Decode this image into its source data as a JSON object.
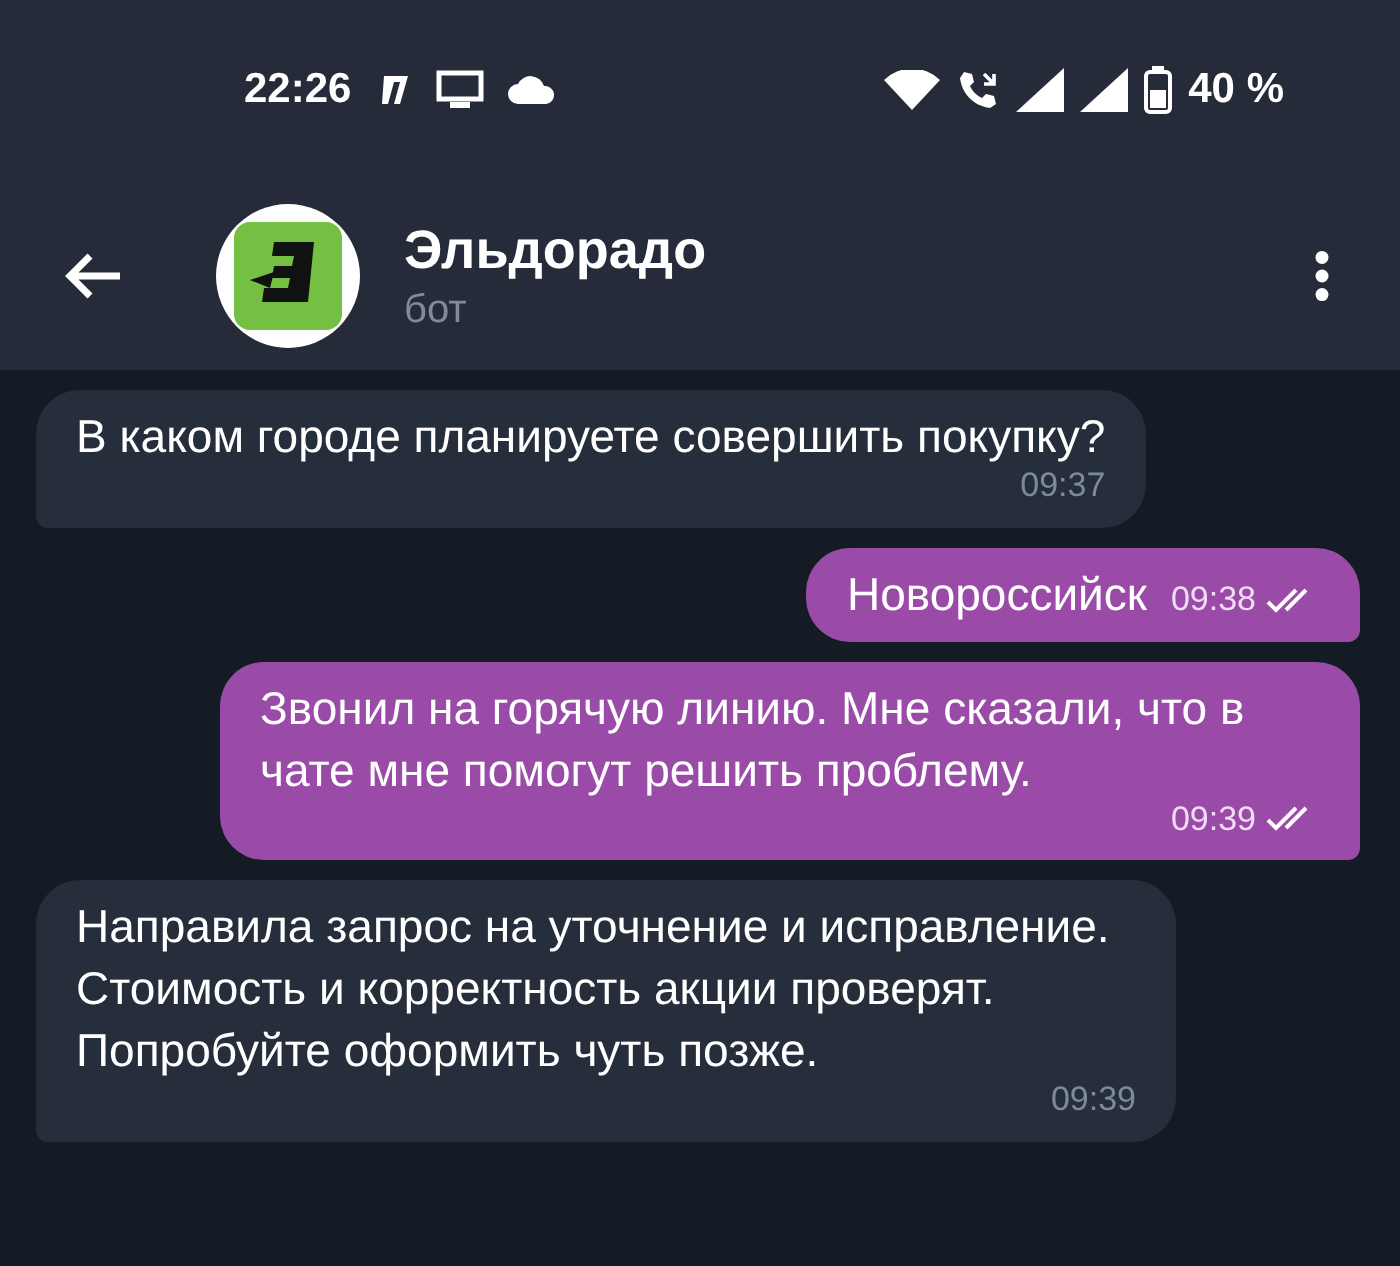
{
  "status_bar": {
    "time": "22:26",
    "battery": "40 %"
  },
  "header": {
    "title": "Эльдорадо",
    "subtitle": "бот"
  },
  "messages": [
    {
      "kind": "incoming",
      "text": "В каком городе планируете совершить покупку?",
      "time": "09:37"
    },
    {
      "kind": "outgoing",
      "text": "Новороссийск",
      "time": "09:38",
      "read": true
    },
    {
      "kind": "outgoing",
      "text": "Звонил на горячую линию. Мне сказали, что в чате мне помогут решить проблему.",
      "time": "09:39",
      "read": true
    },
    {
      "kind": "incoming",
      "text": "Направила запрос на уточнение и исправление. Стоимость и корректность акции проверят. Попробуйте оформить чуть позже.",
      "time": "09:39"
    }
  ]
}
